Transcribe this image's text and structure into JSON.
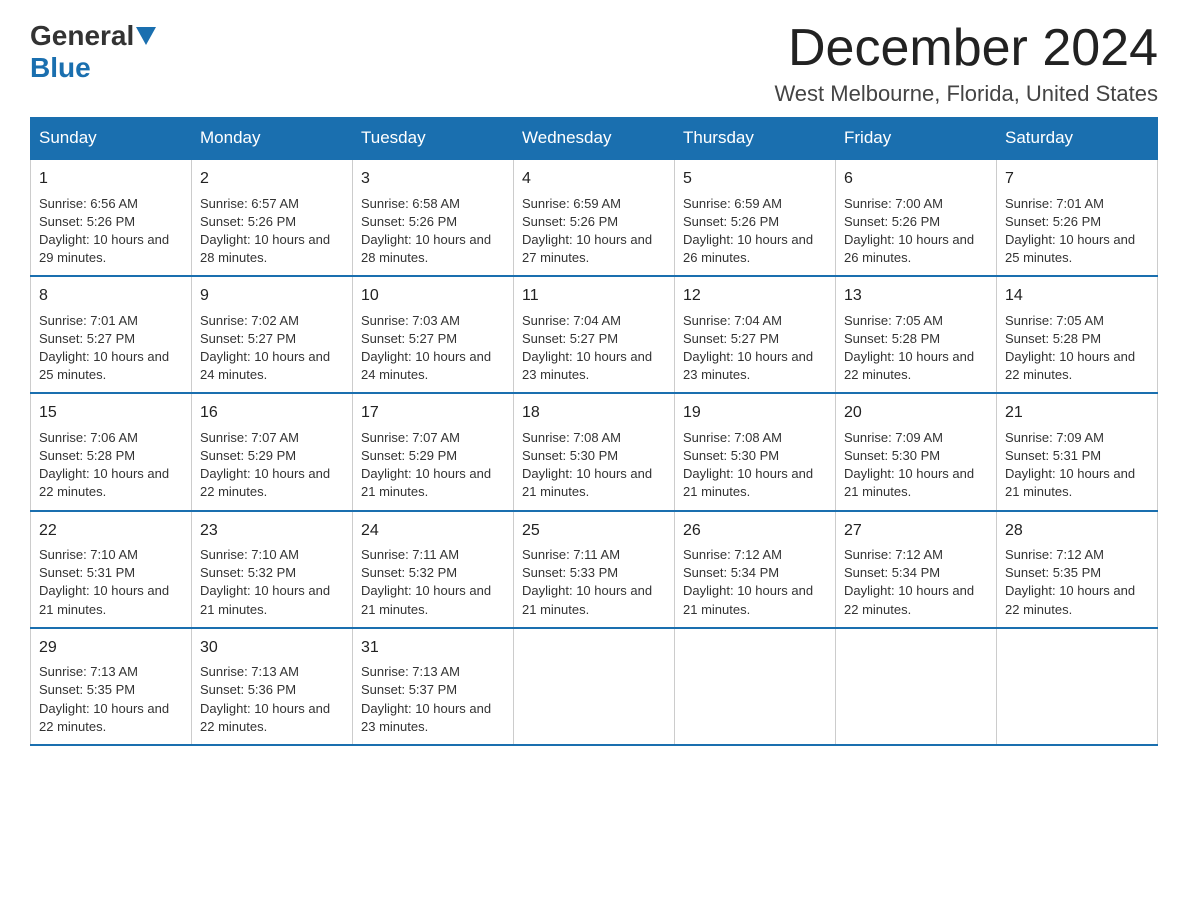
{
  "logo": {
    "general": "General",
    "blue": "Blue"
  },
  "title": "December 2024",
  "location": "West Melbourne, Florida, United States",
  "days_of_week": [
    "Sunday",
    "Monday",
    "Tuesday",
    "Wednesday",
    "Thursday",
    "Friday",
    "Saturday"
  ],
  "weeks": [
    [
      {
        "day": "1",
        "sunrise": "6:56 AM",
        "sunset": "5:26 PM",
        "daylight": "10 hours and 29 minutes."
      },
      {
        "day": "2",
        "sunrise": "6:57 AM",
        "sunset": "5:26 PM",
        "daylight": "10 hours and 28 minutes."
      },
      {
        "day": "3",
        "sunrise": "6:58 AM",
        "sunset": "5:26 PM",
        "daylight": "10 hours and 28 minutes."
      },
      {
        "day": "4",
        "sunrise": "6:59 AM",
        "sunset": "5:26 PM",
        "daylight": "10 hours and 27 minutes."
      },
      {
        "day": "5",
        "sunrise": "6:59 AM",
        "sunset": "5:26 PM",
        "daylight": "10 hours and 26 minutes."
      },
      {
        "day": "6",
        "sunrise": "7:00 AM",
        "sunset": "5:26 PM",
        "daylight": "10 hours and 26 minutes."
      },
      {
        "day": "7",
        "sunrise": "7:01 AM",
        "sunset": "5:26 PM",
        "daylight": "10 hours and 25 minutes."
      }
    ],
    [
      {
        "day": "8",
        "sunrise": "7:01 AM",
        "sunset": "5:27 PM",
        "daylight": "10 hours and 25 minutes."
      },
      {
        "day": "9",
        "sunrise": "7:02 AM",
        "sunset": "5:27 PM",
        "daylight": "10 hours and 24 minutes."
      },
      {
        "day": "10",
        "sunrise": "7:03 AM",
        "sunset": "5:27 PM",
        "daylight": "10 hours and 24 minutes."
      },
      {
        "day": "11",
        "sunrise": "7:04 AM",
        "sunset": "5:27 PM",
        "daylight": "10 hours and 23 minutes."
      },
      {
        "day": "12",
        "sunrise": "7:04 AM",
        "sunset": "5:27 PM",
        "daylight": "10 hours and 23 minutes."
      },
      {
        "day": "13",
        "sunrise": "7:05 AM",
        "sunset": "5:28 PM",
        "daylight": "10 hours and 22 minutes."
      },
      {
        "day": "14",
        "sunrise": "7:05 AM",
        "sunset": "5:28 PM",
        "daylight": "10 hours and 22 minutes."
      }
    ],
    [
      {
        "day": "15",
        "sunrise": "7:06 AM",
        "sunset": "5:28 PM",
        "daylight": "10 hours and 22 minutes."
      },
      {
        "day": "16",
        "sunrise": "7:07 AM",
        "sunset": "5:29 PM",
        "daylight": "10 hours and 22 minutes."
      },
      {
        "day": "17",
        "sunrise": "7:07 AM",
        "sunset": "5:29 PM",
        "daylight": "10 hours and 21 minutes."
      },
      {
        "day": "18",
        "sunrise": "7:08 AM",
        "sunset": "5:30 PM",
        "daylight": "10 hours and 21 minutes."
      },
      {
        "day": "19",
        "sunrise": "7:08 AM",
        "sunset": "5:30 PM",
        "daylight": "10 hours and 21 minutes."
      },
      {
        "day": "20",
        "sunrise": "7:09 AM",
        "sunset": "5:30 PM",
        "daylight": "10 hours and 21 minutes."
      },
      {
        "day": "21",
        "sunrise": "7:09 AM",
        "sunset": "5:31 PM",
        "daylight": "10 hours and 21 minutes."
      }
    ],
    [
      {
        "day": "22",
        "sunrise": "7:10 AM",
        "sunset": "5:31 PM",
        "daylight": "10 hours and 21 minutes."
      },
      {
        "day": "23",
        "sunrise": "7:10 AM",
        "sunset": "5:32 PM",
        "daylight": "10 hours and 21 minutes."
      },
      {
        "day": "24",
        "sunrise": "7:11 AM",
        "sunset": "5:32 PM",
        "daylight": "10 hours and 21 minutes."
      },
      {
        "day": "25",
        "sunrise": "7:11 AM",
        "sunset": "5:33 PM",
        "daylight": "10 hours and 21 minutes."
      },
      {
        "day": "26",
        "sunrise": "7:12 AM",
        "sunset": "5:34 PM",
        "daylight": "10 hours and 21 minutes."
      },
      {
        "day": "27",
        "sunrise": "7:12 AM",
        "sunset": "5:34 PM",
        "daylight": "10 hours and 22 minutes."
      },
      {
        "day": "28",
        "sunrise": "7:12 AM",
        "sunset": "5:35 PM",
        "daylight": "10 hours and 22 minutes."
      }
    ],
    [
      {
        "day": "29",
        "sunrise": "7:13 AM",
        "sunset": "5:35 PM",
        "daylight": "10 hours and 22 minutes."
      },
      {
        "day": "30",
        "sunrise": "7:13 AM",
        "sunset": "5:36 PM",
        "daylight": "10 hours and 22 minutes."
      },
      {
        "day": "31",
        "sunrise": "7:13 AM",
        "sunset": "5:37 PM",
        "daylight": "10 hours and 23 minutes."
      },
      null,
      null,
      null,
      null
    ]
  ],
  "labels": {
    "sunrise": "Sunrise:",
    "sunset": "Sunset:",
    "daylight": "Daylight:"
  }
}
